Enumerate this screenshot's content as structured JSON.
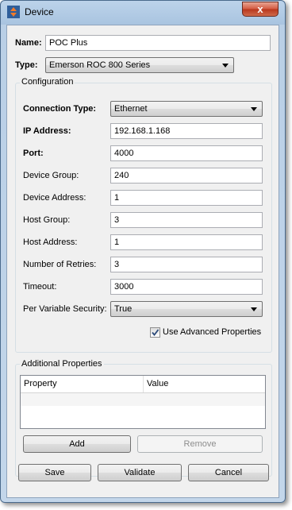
{
  "window": {
    "title": "Device",
    "close_glyph": "x"
  },
  "name_field": {
    "label": "Name:",
    "value": "POC Plus"
  },
  "type_field": {
    "label": "Type:",
    "value": "Emerson ROC 800 Series"
  },
  "configuration": {
    "title": "Configuration",
    "fields": [
      {
        "label": "Connection Type:",
        "value": "Ethernet",
        "kind": "combo",
        "bold": true
      },
      {
        "label": "IP Address:",
        "value": "192.168.1.168",
        "kind": "text",
        "bold": true
      },
      {
        "label": "Port:",
        "value": "4000",
        "kind": "text",
        "bold": true
      },
      {
        "label": "Device Group:",
        "value": "240",
        "kind": "text",
        "bold": false
      },
      {
        "label": "Device Address:",
        "value": "1",
        "kind": "text",
        "bold": false
      },
      {
        "label": "Host Group:",
        "value": "3",
        "kind": "text",
        "bold": false
      },
      {
        "label": "Host Address:",
        "value": "1",
        "kind": "text",
        "bold": false
      },
      {
        "label": "Number of Retries:",
        "value": "3",
        "kind": "text",
        "bold": false
      },
      {
        "label": "Timeout:",
        "value": "3000",
        "kind": "text",
        "bold": false
      },
      {
        "label": "Per Variable Security:",
        "value": "True",
        "kind": "combo",
        "bold": false
      }
    ],
    "advanced_checkbox": {
      "label": "Use Advanced Properties",
      "checked": true
    }
  },
  "additional_properties": {
    "title": "Additional Properties",
    "columns": [
      "Property",
      "Value"
    ],
    "add_label": "Add",
    "remove_label": "Remove"
  },
  "footer": {
    "save_label": "Save",
    "validate_label": "Validate",
    "cancel_label": "Cancel"
  }
}
